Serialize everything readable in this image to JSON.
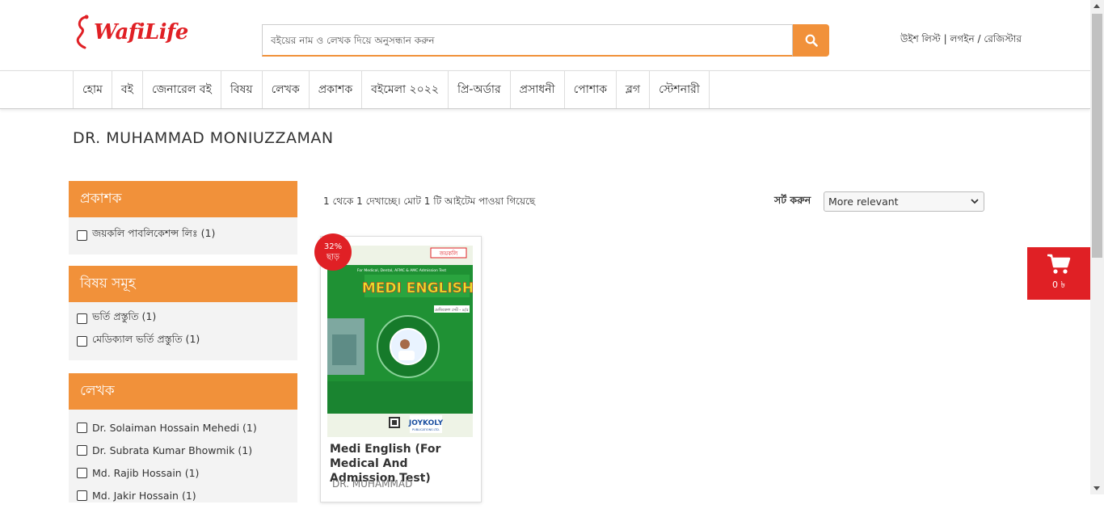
{
  "brand": {
    "logo_text": "WafiLife",
    "color": "#e02025"
  },
  "search": {
    "placeholder": "বইয়ের নাম ও লেখক দিয়ে অনুসন্ধান করুন",
    "icon": "search-icon"
  },
  "account": {
    "wishlist": "উইশ লিস্ট",
    "sep1": " | ",
    "login": "লগইন",
    "sep2": " / ",
    "register": "রেজিস্টার"
  },
  "nav": {
    "items": [
      {
        "label": "হোম"
      },
      {
        "label": "বই"
      },
      {
        "label": "জেনারেল বই"
      },
      {
        "label": "বিষয়"
      },
      {
        "label": "লেখক"
      },
      {
        "label": "প্রকাশক"
      },
      {
        "label": "বইমেলা ২০২২"
      },
      {
        "label": "প্রি-অর্ডার"
      },
      {
        "label": "প্রসাধনী"
      },
      {
        "label": "পোশাক"
      },
      {
        "label": "ব্লগ"
      },
      {
        "label": "স্টেশনারী"
      }
    ]
  },
  "page": {
    "title": "DR. MUHAMMAD MONIUZZAMAN"
  },
  "filters": {
    "publisher": {
      "heading": "প্রকাশক",
      "items": [
        {
          "label": "জয়কলি পাবলিকেশন্স লিঃ (1)"
        }
      ]
    },
    "subject": {
      "heading": "বিষয় সমূহ",
      "items": [
        {
          "label": "ভর্তি প্রস্তুতি (1)"
        },
        {
          "label": "মেডিক্যাল ভর্তি প্রস্তুতি (1)"
        }
      ]
    },
    "author": {
      "heading": "লেখক",
      "items": [
        {
          "label": "Dr. Solaiman Hossain Mehedi (1)"
        },
        {
          "label": "Dr. Subrata Kumar Bhowmik (1)"
        },
        {
          "label": "Md. Rajib Hossain (1)"
        },
        {
          "label": "Md. Jakir Hossain (1)"
        }
      ]
    }
  },
  "results": {
    "count_text": "1 থেকে 1 দেখাচ্ছে। মোট 1 টি আইটেম পাওয়া গিয়েছে"
  },
  "sort": {
    "label": "সর্ট করুন",
    "selected": "More relevant"
  },
  "product": {
    "discount_pct": "32%",
    "discount_word": "ছাড়",
    "title": "Medi English (For Medical And Admission Test)",
    "author": "DR. MUHAMMAD",
    "cover": {
      "publisher_tag": "জয়কলি",
      "subtitle": "For Medical, Dental, AFMC & AMC Admission Test",
      "name": "MEDI ENGLISH",
      "edition_tag": "মেডিকেল সেট - ৪/৫",
      "imprint": "JOYKOLY",
      "imprint_sub": "PUBLICATIONS LTD."
    }
  },
  "cart": {
    "amount": "0 ৳",
    "icon": "cart-icon"
  },
  "colors": {
    "accent": "#f1913a",
    "brand_red": "#e02025",
    "filter_bg": "#f3f3f3"
  }
}
